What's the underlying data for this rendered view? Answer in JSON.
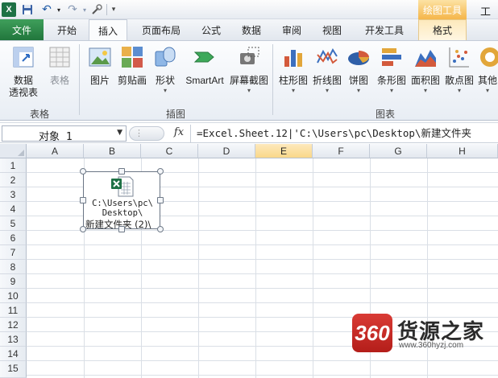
{
  "titlebar": {
    "app_icon": "X",
    "context_tool_title": "绘图工具",
    "window_title": "工作"
  },
  "tabs": [
    {
      "label": "文件"
    },
    {
      "label": "开始"
    },
    {
      "label": "插入"
    },
    {
      "label": "页面布局"
    },
    {
      "label": "公式"
    },
    {
      "label": "数据"
    },
    {
      "label": "审阅"
    },
    {
      "label": "视图"
    },
    {
      "label": "开发工具"
    },
    {
      "label": "格式"
    }
  ],
  "ribbon": {
    "groups": {
      "tables": "表格",
      "illustrations": "插图",
      "charts": "图表"
    },
    "buttons": {
      "pivot_line1": "数据",
      "pivot_line2": "透视表",
      "table": "表格",
      "picture": "图片",
      "clipart": "剪贴画",
      "shapes": "形状",
      "smartart": "SmartArt",
      "screenshot": "屏幕截图",
      "column": "柱形图",
      "line": "折线图",
      "pie": "饼图",
      "bar": "条形图",
      "area": "面积图",
      "scatter": "散点图",
      "other": "其他"
    }
  },
  "formula_bar": {
    "name_box": "对象 1",
    "fx": "fx",
    "formula": "=Excel.Sheet.12|'C:\\Users\\pc\\Desktop\\新建文件夹"
  },
  "grid": {
    "columns": [
      "A",
      "B",
      "C",
      "D",
      "E",
      "F",
      "G",
      "H"
    ],
    "rows": [
      "1",
      "2",
      "3",
      "4",
      "5",
      "6",
      "7",
      "8",
      "9",
      "10",
      "11",
      "12",
      "13",
      "14",
      "15"
    ]
  },
  "embedded_object": {
    "path_line1": "C:\\Users\\pc\\",
    "path_line2": "Desktop\\",
    "name_line": "新建文件夹 (2)\\"
  },
  "watermark": {
    "badge": "360",
    "title": "货源之家",
    "url": "www.360hyzj.com"
  },
  "colors": {
    "file_tab": "#2e8b4f",
    "excel_green": "#1e7145",
    "context_tab": "#f5b64a",
    "selected_header": "#f9d889",
    "watermark_red": "#c8291f"
  }
}
